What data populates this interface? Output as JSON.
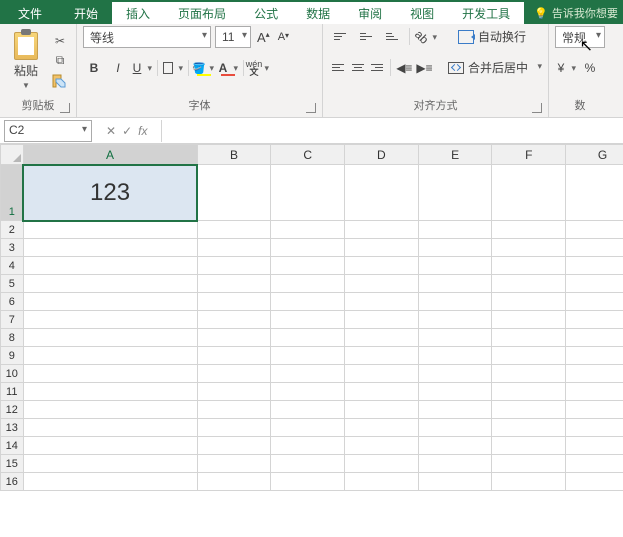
{
  "tabs": {
    "file": "文件",
    "home": "开始",
    "insert": "插入",
    "layout": "页面布局",
    "formulas": "公式",
    "data": "数据",
    "review": "审阅",
    "view": "视图",
    "dev": "开发工具",
    "tell_me": "告诉我你想要"
  },
  "ribbon": {
    "clipboard": {
      "paste": "粘贴",
      "label": "剪贴板"
    },
    "font": {
      "name": "等线",
      "size": "11",
      "bold": "B",
      "italic": "I",
      "underline": "U",
      "ruby": "wén",
      "label": "字体",
      "fontcolor_letter": "A",
      "fill_letter": "A"
    },
    "align": {
      "wrap": "自动换行",
      "merge": "合并后居中",
      "label": "对齐方式"
    },
    "number": {
      "format": "常规",
      "percent": "%",
      "label": "数"
    }
  },
  "namebox": "C2",
  "fx": "fx",
  "columns": [
    "A",
    "B",
    "C",
    "D",
    "E",
    "F",
    "G"
  ],
  "rows": [
    "1",
    "2",
    "3",
    "4",
    "5",
    "6",
    "7",
    "8",
    "9",
    "10",
    "11",
    "12",
    "13",
    "14",
    "15",
    "16"
  ],
  "cells": {
    "A1": "123"
  }
}
